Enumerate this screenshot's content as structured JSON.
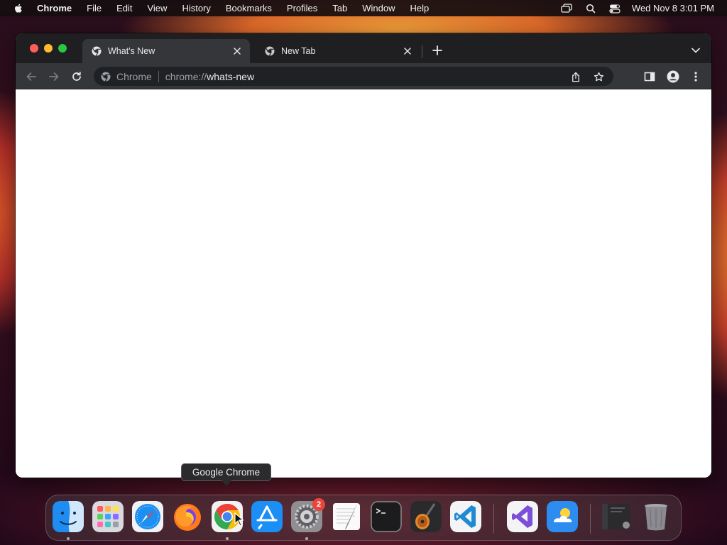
{
  "menubar": {
    "app_name": "Chrome",
    "items": [
      "File",
      "Edit",
      "View",
      "History",
      "Bookmarks",
      "Profiles",
      "Tab",
      "Window",
      "Help"
    ],
    "clock": "Wed Nov 8  3:01 PM",
    "status_icons": [
      "screen-mirroring-icon",
      "spotlight-search-icon",
      "control-center-icon"
    ]
  },
  "browser": {
    "tabs": [
      {
        "title": "What's New",
        "active": true,
        "icon": "chrome-icon"
      },
      {
        "title": "New Tab",
        "active": false,
        "icon": "chrome-icon"
      }
    ],
    "omnibox": {
      "chip": "Chrome",
      "scheme": "chrome://",
      "host": "whats-new"
    }
  },
  "tooltip": {
    "text": "Google Chrome"
  },
  "dock": {
    "apps": [
      {
        "name": "Finder",
        "running": true
      },
      {
        "name": "Launchpad",
        "running": false
      },
      {
        "name": "Safari",
        "running": false
      },
      {
        "name": "Firefox",
        "running": false
      },
      {
        "name": "Google Chrome",
        "running": true
      },
      {
        "name": "App Store",
        "running": false
      },
      {
        "name": "System Settings",
        "running": true,
        "badge": "2"
      },
      {
        "name": "TextEdit",
        "running": false
      },
      {
        "name": "Terminal",
        "running": false
      },
      {
        "name": "GarageBand",
        "running": false
      },
      {
        "name": "Visual Studio Code",
        "running": false
      },
      {
        "name": "Visual Studio",
        "running": false
      },
      {
        "name": "Weather",
        "running": false
      },
      {
        "name": "Window Preview",
        "running": false
      },
      {
        "name": "Trash",
        "running": false
      }
    ]
  },
  "colors": {
    "tabstrip": "#1f1f21",
    "toolbar": "#35363a",
    "omnibox": "#202124",
    "close": "#fe5f57",
    "minimize": "#febc2e",
    "maximize": "#28c840",
    "badge": "#e8453c"
  }
}
